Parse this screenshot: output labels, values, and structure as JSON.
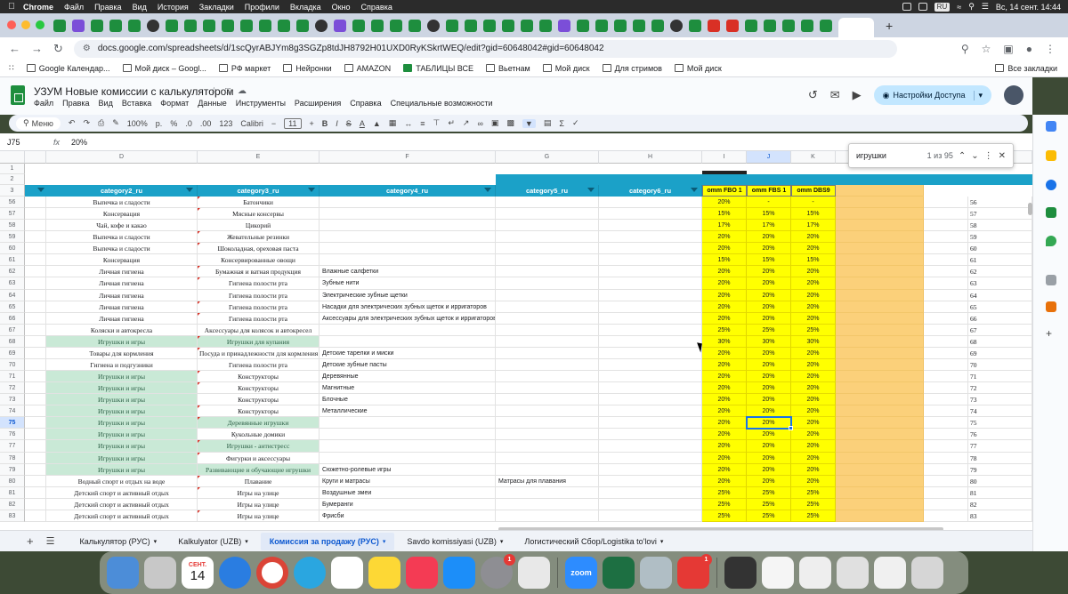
{
  "menubar": {
    "app": "Chrome",
    "items": [
      "Файл",
      "Правка",
      "Вид",
      "История",
      "Закладки",
      "Профили",
      "Вкладка",
      "Окно",
      "Справка"
    ],
    "lang": "RU",
    "datetime": "Вс, 14 сент.  14:44"
  },
  "address": {
    "url": "docs.google.com/spreadsheets/d/1scQyrABJYm8g3SGZp8tdJH8792H01UXD0RyKSkrtWEQ/edit?gid=60648042#gid=60648042"
  },
  "bookmarks": {
    "items": [
      "Google Календар...",
      "Мой диск – Googl...",
      "РФ маркет",
      "Нейронки",
      "AMAZON",
      "ТАБЛИЦЫ ВСЕ",
      "Вьетнам",
      "Мой диск",
      "Для стримов",
      "Мой диск"
    ],
    "all": "Все закладки"
  },
  "doc": {
    "title": "УЗУМ Новые комиссии с калькулятором",
    "menus": [
      "Файл",
      "Правка",
      "Вид",
      "Вставка",
      "Формат",
      "Данные",
      "Инструменты",
      "Расширения",
      "Справка",
      "Специальные возможности"
    ],
    "share_label": "Настройки Доступа"
  },
  "toolbar": {
    "search_label": "Меню",
    "zoom": "100%",
    "currency": "р.",
    "percent": "%",
    "decimals_dec": ".0",
    "decimals_inc": ".00",
    "format123": "123",
    "font": "Calibri",
    "font_size": "11",
    "bold": "B",
    "italic": "I",
    "strike": "S",
    "textcolor": "A"
  },
  "formula": {
    "cell_ref": "J75",
    "fx": "fx",
    "value": "20%"
  },
  "find": {
    "query": "игрушки",
    "count": "1 из 95"
  },
  "columns": [
    "D",
    "E",
    "F",
    "G",
    "H",
    "I",
    "J",
    "K"
  ],
  "header_row": {
    "d": "category2_ru",
    "e": "category3_ru",
    "f": "category4_ru",
    "g": "category5_ru",
    "h": "category6_ru",
    "i": "omm FBO 1",
    "j": "omm FBS 1",
    "k": "omm DBS9"
  },
  "rows": [
    {
      "n": "56",
      "d": "Выпечка и сладости",
      "e": "Батончики",
      "f": "",
      "g": "",
      "i": "20%",
      "j": "-",
      "k": "-"
    },
    {
      "n": "57",
      "d": "Консервация",
      "e": "Мясные консервы",
      "f": "",
      "g": "",
      "i": "15%",
      "j": "15%",
      "k": "15%"
    },
    {
      "n": "58",
      "d": "Чай, кофе и какао",
      "e": "Цикорий",
      "f": "",
      "g": "",
      "i": "17%",
      "j": "17%",
      "k": "17%"
    },
    {
      "n": "59",
      "d": "Выпечка и сладости",
      "e": "Жевательные резинки",
      "f": "",
      "g": "",
      "i": "20%",
      "j": "20%",
      "k": "20%"
    },
    {
      "n": "60",
      "d": "Выпечка и сладости",
      "e": "Шоколадная, ореховая паста",
      "f": "",
      "g": "",
      "i": "20%",
      "j": "20%",
      "k": "20%"
    },
    {
      "n": "61",
      "d": "Консервация",
      "e": "Консервированные овощи",
      "f": "",
      "g": "",
      "i": "15%",
      "j": "15%",
      "k": "15%"
    },
    {
      "n": "62",
      "d": "Личная гигиена",
      "e": "Бумажная и ватная продукция",
      "f": "Влажные салфетки",
      "g": "",
      "i": "20%",
      "j": "20%",
      "k": "20%"
    },
    {
      "n": "63",
      "d": "Личная гигиена",
      "e": "Гигиена полости рта",
      "f": "Зубные нити",
      "g": "",
      "i": "20%",
      "j": "20%",
      "k": "20%"
    },
    {
      "n": "64",
      "d": "Личная гигиена",
      "e": "Гигиена полости рта",
      "f": "Электрические зубные щетки",
      "g": "",
      "i": "20%",
      "j": "20%",
      "k": "20%"
    },
    {
      "n": "65",
      "d": "Личная гигиена",
      "e": "Гигиена полости рта",
      "f": "Насадки для электрических зубных щеток и ирригаторов",
      "g": "",
      "i": "20%",
      "j": "20%",
      "k": "20%"
    },
    {
      "n": "66",
      "d": "Личная гигиена",
      "e": "Гигиена полости рта",
      "f": "Аксессуары для электрических зубных щеток и ирригаторов",
      "g": "",
      "i": "20%",
      "j": "20%",
      "k": "20%"
    },
    {
      "n": "67",
      "d": "Коляски и автокресла",
      "e": "Аксессуары для колясок и автокресел",
      "f": "",
      "g": "",
      "i": "25%",
      "j": "25%",
      "k": "25%"
    },
    {
      "n": "68",
      "d": "Игрушки и игры",
      "e": "Игрушки для купания",
      "f": "",
      "g": "",
      "i": "30%",
      "j": "30%",
      "k": "30%",
      "hd": true,
      "he": true
    },
    {
      "n": "69",
      "d": "Товары для кормления",
      "e": "Посуда и принадлежности для кормления",
      "f": "Детские тарелки и миски",
      "g": "",
      "i": "20%",
      "j": "20%",
      "k": "20%"
    },
    {
      "n": "70",
      "d": "Гигиена и подгузники",
      "e": "Гигиена полости рта",
      "f": "Детские зубные пасты",
      "g": "",
      "i": "20%",
      "j": "20%",
      "k": "20%"
    },
    {
      "n": "71",
      "d": "Игрушки и игры",
      "e": "Конструкторы",
      "f": "Деревянные",
      "g": "",
      "i": "20%",
      "j": "20%",
      "k": "20%",
      "hd": true
    },
    {
      "n": "72",
      "d": "Игрушки и игры",
      "e": "Конструкторы",
      "f": "Магнитные",
      "g": "",
      "i": "20%",
      "j": "20%",
      "k": "20%",
      "hd": true
    },
    {
      "n": "73",
      "d": "Игрушки и игры",
      "e": "Конструкторы",
      "f": "Блочные",
      "g": "",
      "i": "20%",
      "j": "20%",
      "k": "20%",
      "hd": true
    },
    {
      "n": "74",
      "d": "Игрушки и игры",
      "e": "Конструкторы",
      "f": "Металлические",
      "g": "",
      "i": "20%",
      "j": "20%",
      "k": "20%",
      "hd": true
    },
    {
      "n": "75",
      "d": "Игрушки и игры",
      "e": "Деревянные игрушки",
      "f": "",
      "g": "",
      "i": "20%",
      "j": "20%",
      "k": "20%",
      "hd": true,
      "he": true,
      "sel": true
    },
    {
      "n": "76",
      "d": "Игрушки и игры",
      "e": "Кукольные домики",
      "f": "",
      "g": "",
      "i": "20%",
      "j": "20%",
      "k": "20%",
      "hd": true
    },
    {
      "n": "77",
      "d": "Игрушки и игры",
      "e": "Игрушки - антистресс",
      "f": "",
      "g": "",
      "i": "20%",
      "j": "20%",
      "k": "20%",
      "hd": true,
      "he": true
    },
    {
      "n": "78",
      "d": "Игрушки и игры",
      "e": "Фигурки и аксессуары",
      "f": "",
      "g": "",
      "i": "20%",
      "j": "20%",
      "k": "20%",
      "hd": true
    },
    {
      "n": "79",
      "d": "Игрушки и игры",
      "e": "Развивающие и обучающие игрушки",
      "f": "Сюжетно-ролевые игры",
      "g": "",
      "i": "20%",
      "j": "20%",
      "k": "20%",
      "hd": true,
      "he": true
    },
    {
      "n": "80",
      "d": "Водный спорт и отдых на воде",
      "e": "Плавание",
      "f": "Круги и матрасы",
      "g": "Матрасы для плавания",
      "i": "20%",
      "j": "20%",
      "k": "20%"
    },
    {
      "n": "81",
      "d": "Детский спорт и активный отдых",
      "e": "Игры на улице",
      "f": "Воздушные змеи",
      "g": "",
      "i": "25%",
      "j": "25%",
      "k": "25%"
    },
    {
      "n": "82",
      "d": "Детский спорт и активный отдых",
      "e": "Игры на улице",
      "f": "Бумеранги",
      "g": "",
      "i": "25%",
      "j": "25%",
      "k": "25%"
    },
    {
      "n": "83",
      "d": "Детский спорт и активный отдых",
      "e": "Игры на улице",
      "f": "Фрисби",
      "g": "",
      "i": "25%",
      "j": "25%",
      "k": "25%"
    }
  ],
  "sheet_tabs": [
    {
      "label": "Калькулятор (РУС)",
      "active": false
    },
    {
      "label": "Kalkulyator (UZB)",
      "active": false
    },
    {
      "label": "Комиссия за продажу (РУС)",
      "active": true
    },
    {
      "label": "Savdo komissiyasi (UZB)",
      "active": false
    },
    {
      "label": "Логистический Сбор/Logistika to'lovi",
      "active": false
    }
  ],
  "dock": {
    "calendar_month": "СЕНТ.",
    "calendar_day": "14",
    "zoom_label": "zoom",
    "badge_settings": "1",
    "badge_office": "1"
  },
  "colors": {
    "header_blue": "#1ba1c8",
    "yellow": "#ffff00",
    "orange": "#fbd07a",
    "find_green": "#c9e9d6",
    "select_blue": "#1a73e8"
  }
}
